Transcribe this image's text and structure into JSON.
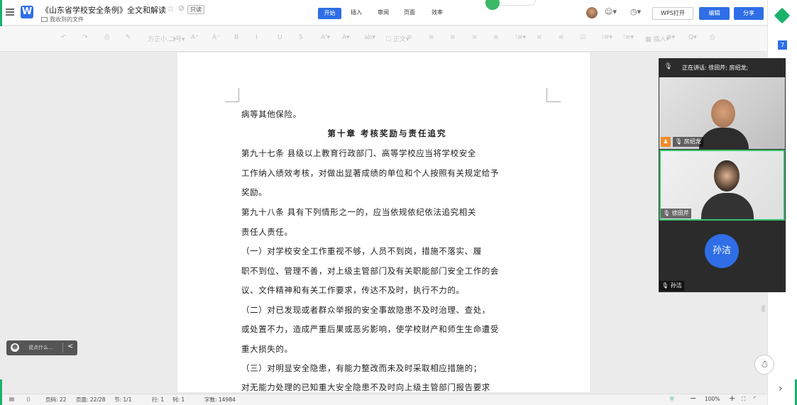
{
  "titlebar": {
    "logo_letter": "W",
    "doc_title": "《山东省学校安全条例》全文和解读",
    "folder": "我收到的文件",
    "readonly": "只读",
    "tabs": [
      "开始",
      "插入",
      "审阅",
      "页面",
      "效率"
    ],
    "wps_open": "WPS打开",
    "edit": "编辑",
    "share": "分享"
  },
  "toolbar": {
    "items": [
      "↶",
      "↷",
      "⎙",
      "✎",
      "方正小...▾",
      "二号▾",
      "A⁺",
      "A⁻",
      "B",
      "I",
      "U",
      "S",
      "A'▾",
      "A▾",
      "ab▾",
      "☐ 正文▾",
      "≡",
      "≡",
      "≡",
      "≡",
      "≡",
      "⁝≡▾",
      "≡",
      "≡",
      "☑",
      "⁝≡▾",
      "⁝≡▾",
      "▦ 插入▾",
      "⊕▾",
      "Q▾",
      "⎙"
    ]
  },
  "document": {
    "lines": [
      "病等其他保险。",
      "第十章   考核奖励与责任追究",
      "    第九十七条  县级以上教育行政部门、高等学校应当将学校安全",
      "工作纳入绩效考核，对做出显著成绩的单位和个人按照有关规定给予",
      "奖励。",
      "    第九十八条  具有下列情形之一的，应当依规依纪依法追究相关",
      "责任人责任。",
      "    （一）对学校安全工作重视不够，人员不到岗，措施不落实、履",
      "职不到位、管理不善，对上级主管部门及有关职能部门安全工作的会",
      "议、文件精神和有关工作要求，传达不及时，执行不力的。",
      "    （二）对已发现或者群众举报的安全事故隐患不及时治理、查处，",
      "或处置不力，造成严重后果或恶劣影响，使学校财产和师生生命遭受",
      "重大损失的。",
      "    （三）对明显安全隐患，有能力整改而未及时采取相应措施的；",
      "对无能力处理的已知重大安全隐患不及时向上级主管部门报告要求"
    ]
  },
  "meeting": {
    "speaking": "正在讲话: 徐田芹; 房绍龙;",
    "participants": [
      {
        "name": "房绍龙"
      },
      {
        "name": "徐田芹"
      },
      {
        "name": "孙洁"
      }
    ],
    "avatar_text": "孙洁"
  },
  "comment": {
    "placeholder": "说点什么...",
    "collapse": "<"
  },
  "statusbar": {
    "page_num": "页码: 22",
    "page_of": "页面: 22/28",
    "section": "节: 1/1",
    "row": "行: 1",
    "col": "列: 1",
    "words": "字数: 14984",
    "zoom": "100%"
  }
}
